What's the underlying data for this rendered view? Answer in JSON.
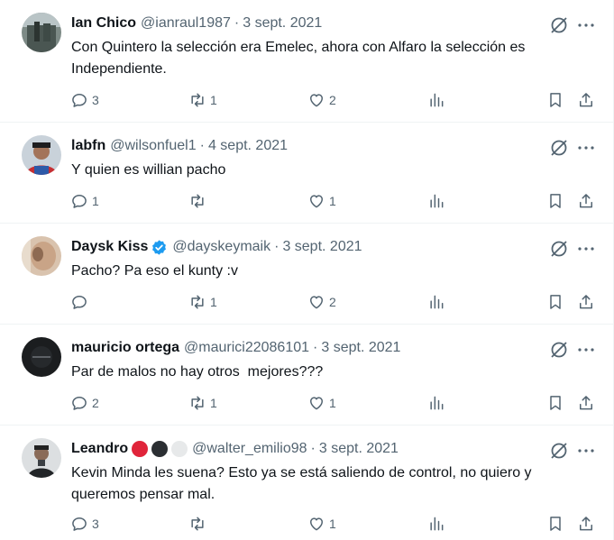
{
  "tweets": [
    {
      "name": "Ian Chico",
      "handle": "@ianraul1987",
      "date": "3 sept. 2021",
      "text": "Con Quintero la selección era Emelec, ahora con Alfaro la selección es Independiente.",
      "replies": "3",
      "retweets": "1",
      "likes": "2"
    },
    {
      "name": "labfn",
      "handle": "@wilsonfuel1",
      "date": "4 sept. 2021",
      "text": "Y quien es willian pacho",
      "replies": "1",
      "retweets": "",
      "likes": "1"
    },
    {
      "name": "Daysk Kiss",
      "handle": "@dayskeymaik",
      "date": "3 sept. 2021",
      "text": "Pacho? Pa eso el kunty :v",
      "replies": "",
      "retweets": "1",
      "likes": "2",
      "verified": true
    },
    {
      "name": "mauricio ortega",
      "handle": "@maurici22086101",
      "date": "3 sept. 2021",
      "text": "Par de malos no hay otros  mejores???",
      "replies": "2",
      "retweets": "1",
      "likes": "1"
    },
    {
      "name": "Leandro",
      "handle": "@walter_emilio98",
      "date": "3 sept. 2021",
      "text": "Kevin Minda les suena? Esto ya se está saliendo de control, no quiero y queremos pensar mal.",
      "replies": "3",
      "retweets": "",
      "likes": "1",
      "name_emoji": [
        "red-circle",
        "black-circle",
        "white-circle"
      ]
    }
  ],
  "icons": {
    "reply": "reply-icon",
    "retweet": "retweet-icon",
    "like": "heart-icon",
    "views": "views-icon",
    "bookmark": "bookmark-icon",
    "share": "share-icon",
    "grok": "grok-icon",
    "more": "more-icon",
    "verified": "verified-badge-icon"
  },
  "colors": {
    "text": "#0f1419",
    "secondary": "#536471",
    "verified": "#1d9bf0",
    "divider": "#eff3f4",
    "red_circle": "#e0243a",
    "black_circle": "#2b2f33",
    "white_circle": "#e7e9ea"
  }
}
